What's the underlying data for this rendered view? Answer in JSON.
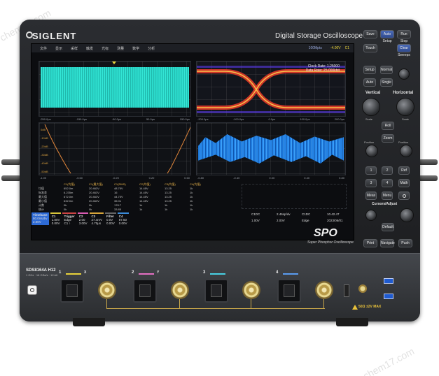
{
  "brand": {
    "name": "SIGLENT",
    "device_title": "Digital Storage Oscilloscope"
  },
  "screen": {
    "menu": [
      "文件",
      "显示",
      "采样",
      "触发",
      "光标",
      "测量",
      "数学",
      "分析"
    ],
    "menu_status": [
      "100Mpts",
      "-4.00V",
      "C1"
    ],
    "eye": {
      "clock_rate": "Clock Rate: 1.25000",
      "data_rate": "Data Rate: 25.000kbit"
    },
    "time_axis_top": [
      "-250.0ps",
      "-200.0ps",
      "-150.0ps",
      "-100.0ps",
      "-50.0ps",
      "0.0ps",
      "50.0ps",
      "100.0ps",
      "150.0ps",
      "200.0ps"
    ],
    "time_axis_bottom": [
      "-1.00",
      "-0.80",
      "-0.60",
      "-0.40",
      "-0.20",
      "0.00",
      "0.20",
      "0.40",
      "0.60",
      "0.80"
    ],
    "fft_levels": [
      "0dB",
      "-10dB",
      "-20dB",
      "-30dB",
      "-40dB",
      "-50dB"
    ],
    "table": {
      "headers": [
        "",
        "C1(均值)",
        "C1(最大值)",
        "C1(RMS)",
        "C2(均值)",
        "C3(均值)",
        "C4(均值)"
      ],
      "rows": [
        [
          "均值",
          "652.0m",
          "20.463V",
          "48.75V",
          "14.45V",
          "13.25",
          "1k"
        ],
        [
          "标准差",
          "6.235m",
          "20.463V",
          "16",
          "14.45V",
          "13.25",
          "1k"
        ],
        [
          "最大值",
          "672.0m",
          "20.463V",
          "44.75V",
          "14.45V",
          "13.25",
          "1k"
        ],
        [
          "最小值",
          "632.0m",
          "20.463V",
          "36.0k",
          "14.45V",
          "13.25",
          "1k"
        ],
        [
          "计数",
          "0k",
          "0k",
          "178.7",
          "1k",
          "1k",
          "1k"
        ],
        [
          "统计",
          "0k",
          "0k",
          "33.85",
          "1k",
          "1k",
          "1k"
        ]
      ]
    },
    "status_chips": [
      {
        "title": "Timebase",
        "line1": "80.0ns/div",
        "line2": "2.00V",
        "color": "#2e6bd6"
      },
      {
        "title": "C1",
        "line1": "1.00V",
        "line2": "0.00V",
        "color": "#d8c43a"
      },
      {
        "title": "Trigger",
        "line1": "Edge",
        "line2": "C1 ↑",
        "color": "#c44"
      },
      {
        "title": "C2",
        "line1": "2.00",
        "line2": "3.00V",
        "color": "#d95bb3"
      },
      {
        "title": "C3",
        "line1": "27.4mV",
        "line2": "4.70μs",
        "color": "#d8a53a"
      },
      {
        "title": "Filter",
        "line1": "0.0V",
        "line2": "0.00V",
        "color": "#555"
      },
      {
        "title": "C4",
        "line1": "87.50 ",
        "line2": "0.00V",
        "color": "#3a8ad8"
      }
    ],
    "status_right": [
      "C1DC",
      "2.46sp/dv",
      "C1DC",
      "10.42.47",
      "1.00V",
      "2.00V",
      "Edge",
      "2023/06/01"
    ]
  },
  "spo": {
    "logo": "SPO",
    "subtitle": "Super Phosphor Oscilloscope"
  },
  "front": {
    "model": "SDS8164A H12",
    "model_sub": "1 GHz · 16 GSa/s · 12-bit",
    "channels": [
      {
        "num": "1",
        "sub": "X",
        "color": "#e8d23a"
      },
      {
        "num": "2",
        "sub": "Y",
        "color": "#e46fc3"
      },
      {
        "num": "3",
        "sub": "",
        "color": "#48d1e4"
      },
      {
        "num": "4",
        "sub": "",
        "color": "#5a9cf0"
      }
    ],
    "max_warning": "50Ω ±2V MAX"
  },
  "panel": {
    "top_buttons": [
      "Save",
      "Auto Setup",
      "Run Stop"
    ],
    "touch_buttons": [
      "Touch",
      "Clear Sweeps"
    ],
    "trigger_buttons": [
      "Setup",
      "Normal",
      "Auto",
      "Single"
    ],
    "vertical_label": "Vertical",
    "horizontal_label": "Horizontal",
    "ch_buttons": [
      "1",
      "2",
      "3",
      "4"
    ],
    "misc_buttons": [
      "Roll",
      "Zoom",
      "Ref",
      "Math",
      "Meas",
      "Menu"
    ],
    "cursor_label": "Cursors/Adjust",
    "bottom_buttons": [
      "Default",
      "Navigate",
      "Print",
      "Push"
    ],
    "knob_labels": [
      "Position",
      "Scale",
      "Position",
      "Scale"
    ]
  }
}
